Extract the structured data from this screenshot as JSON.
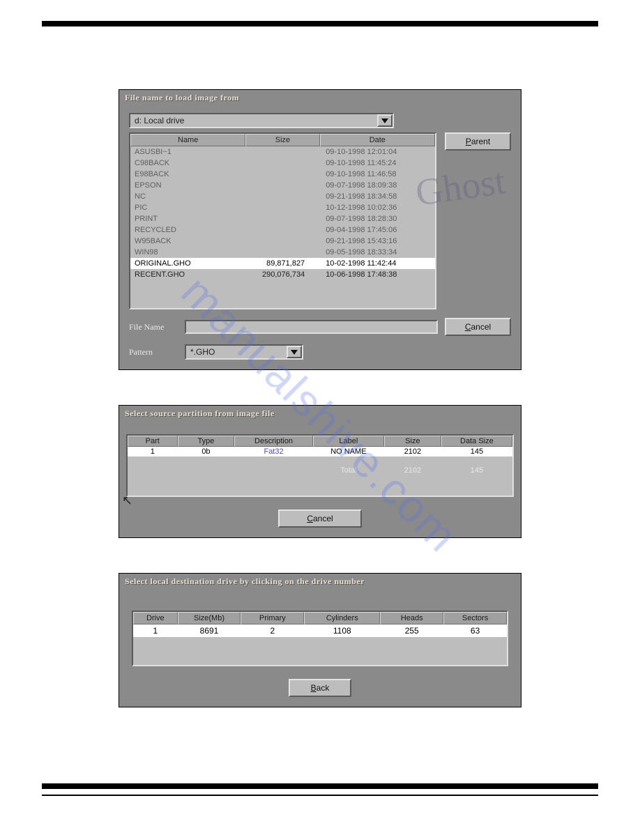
{
  "watermark": "manualshive.com",
  "dialog1": {
    "title": "File name to load image from",
    "drive_selected": "d: Local drive",
    "columns": {
      "name": "Name",
      "size": "Size",
      "date": "Date"
    },
    "files": [
      {
        "name": "ASUSBI~1",
        "size": "",
        "date": "09-10-1998 12:01:04",
        "dim": true
      },
      {
        "name": "C98BACK",
        "size": "",
        "date": "09-10-1998 11:45:24",
        "dim": true
      },
      {
        "name": "E98BACK",
        "size": "",
        "date": "09-10-1998 11:46:58",
        "dim": true
      },
      {
        "name": "EPSON",
        "size": "",
        "date": "09-07-1998 18:09:38",
        "dim": true
      },
      {
        "name": "NC",
        "size": "",
        "date": "09-21-1998 18:34:58",
        "dim": true
      },
      {
        "name": "PIC",
        "size": "",
        "date": "10-12-1998 10:02:36",
        "dim": true
      },
      {
        "name": "PRINT",
        "size": "",
        "date": "09-07-1998 18:28:30",
        "dim": true
      },
      {
        "name": "RECYCLED",
        "size": "",
        "date": "09-04-1998 17:45:06",
        "dim": true
      },
      {
        "name": "W95BACK",
        "size": "",
        "date": "09-21-1998 15:43:16",
        "dim": true
      },
      {
        "name": "WIN98",
        "size": "",
        "date": "09-05-1998 18:33:34",
        "dim": true
      },
      {
        "name": "ORIGINAL.GHO",
        "size": "89,871,827",
        "date": "10-02-1998 11:42:44",
        "selected": true
      },
      {
        "name": "RECENT.GHO",
        "size": "290,076,734",
        "date": "10-06-1998 17:48:38",
        "enabled": true
      }
    ],
    "buttons": {
      "parent": "Parent",
      "cancel": "Cancel"
    },
    "filename_label": "File Name",
    "filename_value": "",
    "pattern_label": "Pattern",
    "pattern_value": "*.GHO",
    "logo_text": "Ghost"
  },
  "dialog2": {
    "title": "Select source partition from image file",
    "columns": {
      "part": "Part",
      "type": "Type",
      "desc": "Description",
      "label": "Label",
      "size": "Size",
      "data": "Data Size"
    },
    "row": {
      "part": "1",
      "type": "0b",
      "desc": "Fat32",
      "label": "NO NAME",
      "size": "2102",
      "data": "145"
    },
    "total_label": "Total",
    "total_size": "2102",
    "total_data": "145",
    "cancel": "Cancel"
  },
  "dialog3": {
    "title": "Select local destination drive by clicking on the drive number",
    "columns": {
      "drive": "Drive",
      "size": "Size(Mb)",
      "primary": "Primary",
      "cyl": "Cylinders",
      "heads": "Heads",
      "sectors": "Sectors"
    },
    "row": {
      "drive": "1",
      "size": "8691",
      "primary": "2",
      "cyl": "1108",
      "heads": "255",
      "sectors": "63"
    },
    "back": "Back"
  }
}
